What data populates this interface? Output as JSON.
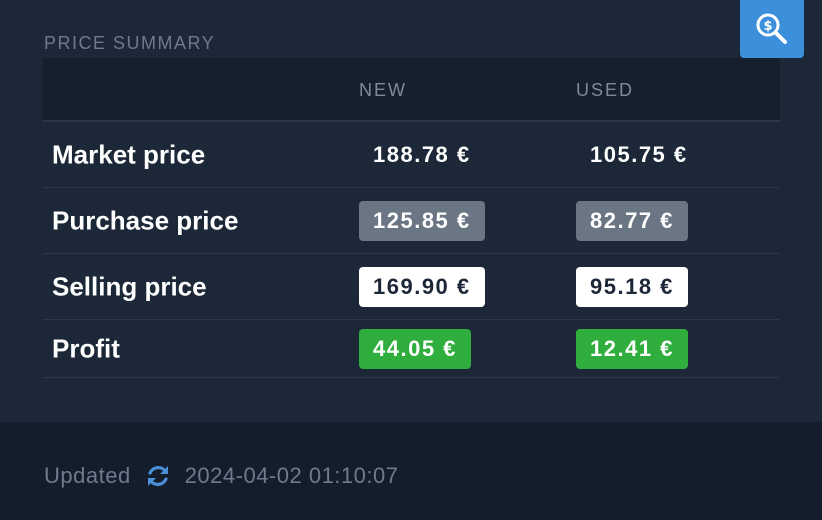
{
  "section_title": "PRICE SUMMARY",
  "columns": {
    "new": "NEW",
    "used": "USED"
  },
  "rows": [
    {
      "label": "Market price",
      "new": "188.78 €",
      "used": "105.75 €",
      "style": "plain"
    },
    {
      "label": "Purchase price",
      "new": "125.85 €",
      "used": "82.77 €",
      "style": "gray"
    },
    {
      "label": "Selling price",
      "new": "169.90 €",
      "used": "95.18 €",
      "style": "white"
    },
    {
      "label": "Profit",
      "new": "44.05 €",
      "used": "12.41 €",
      "style": "green"
    }
  ],
  "footer": {
    "updated_label": "Updated",
    "timestamp": "2024-04-02 01:10:07"
  },
  "icons": {
    "search_button": "search-dollar-icon",
    "refresh": "refresh-icon"
  },
  "colors": {
    "accent": "#3d8fdb",
    "profit": "#2fad3d",
    "purchase_badge": "#6b7685",
    "background": "#1c2738"
  }
}
